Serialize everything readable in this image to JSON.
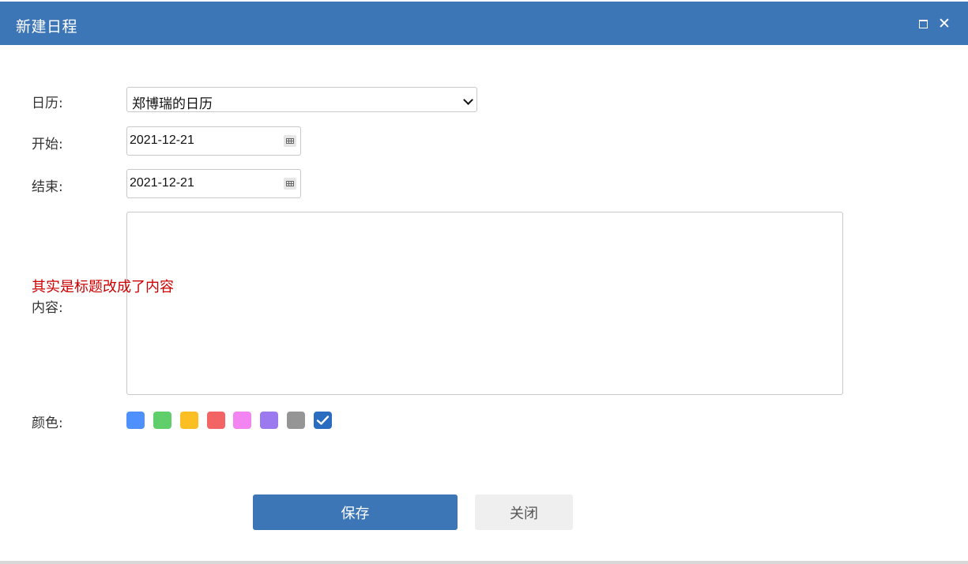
{
  "dialog": {
    "title": "新建日程"
  },
  "form": {
    "calendar_label": "日历:",
    "calendar_value": "郑博瑞的日历",
    "start_label": "开始:",
    "start_value": "2021-12-21",
    "end_label": "结束:",
    "end_value": "2021-12-21",
    "annotation": "其实是标题改成了内容",
    "content_label": "内容:",
    "content_value": "",
    "color_label": "颜色:",
    "colors": [
      "#4d90fe",
      "#5fce6b",
      "#fbbf24",
      "#f36464",
      "#f385f3",
      "#9b7af0",
      "#959595",
      "#2a6cbf"
    ],
    "selected_color_index": 7
  },
  "actions": {
    "save_label": "保存",
    "close_label": "关闭"
  }
}
